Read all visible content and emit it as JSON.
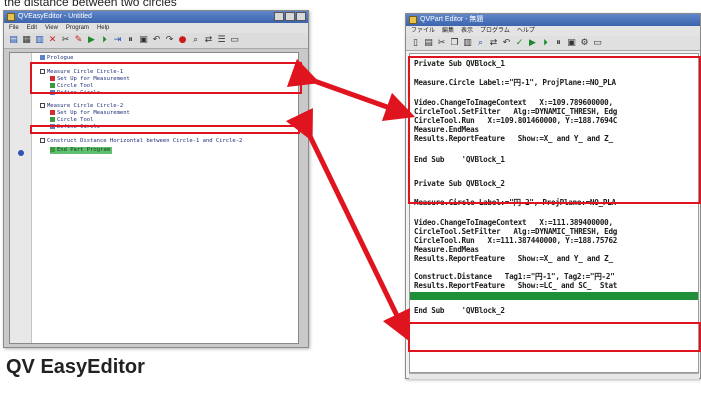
{
  "captions": {
    "top": "the distance between two circles",
    "bottom": "QV EasyEditor"
  },
  "left_window": {
    "title": "QVEasyEditor - Untitled",
    "menu": [
      "File",
      "Edit",
      "View",
      "Program",
      "Help"
    ],
    "tree": [
      "Prologue",
      "Measure Circle Circle-1",
      "Set Up for Measurement",
      "Circle Tool",
      "Define Circle",
      "Measure Circle Circle-2",
      "Set Up for Measurement",
      "Circle Tool",
      "Define Circle",
      "Construct Distance Horizontal between Circle-1 and Circle-2",
      "End Part Program"
    ]
  },
  "right_window": {
    "title": "QVPart Editor - 無題",
    "menu": [
      "ファイル",
      "編集",
      "表示",
      "プログラム",
      "ヘルプ"
    ],
    "code": {
      "b1_sub": "Private Sub QVBlock_1",
      "b1_measure": "Measure.Circle Label:=\"円-1\", ProjPlane:=NO_PLA",
      "b1_video": "Video.ChangeToImageContext   X:=109.789600000,",
      "b1_setfilter": "CircleTool.SetFilter   Alg:=DYNAMIC_THRESH, Edg",
      "b1_run": "CircleTool.Run   X:=109.801460000, Y:=188.7694C",
      "b1_endmeas": "Measure.EndMeas",
      "b1_report": "Results.ReportFeature   Show:=X_ and Y_ and Z_",
      "b1_end": "End Sub    'QVBlock_1",
      "b2_sub": "Private Sub QVBlock_2",
      "b2_measure": "Measure.Circle Label:=\"円-2\", ProjPlane:=NO_PLA",
      "b2_video": "Video.ChangeToImageContext   X:=111.389400000,",
      "b2_setfilter": "CircleTool.SetFilter   Alg:=DYNAMIC_THRESH, Edg",
      "b2_run": "CircleTool.Run   X:=111.387440000, Y:=188.75762",
      "b2_endmeas": "Measure.EndMeas",
      "b2_report": "Results.ReportFeature   Show:=X_ and Y_ and Z_",
      "construct": "Construct.Distance   Tag1:=\"円-1\", Tag2:=\"円-2\"",
      "c_report": "Results.ReportFeature   Show:=LC_ and SC_  Stat",
      "b2_end": "End Sub    'QVBlock_2"
    }
  },
  "colors": {
    "highlight_red": "#e0141e",
    "selection_green": "#5ec06e",
    "code_green_bar": "#1f8f3a",
    "title_blue": "#3c64ad"
  }
}
